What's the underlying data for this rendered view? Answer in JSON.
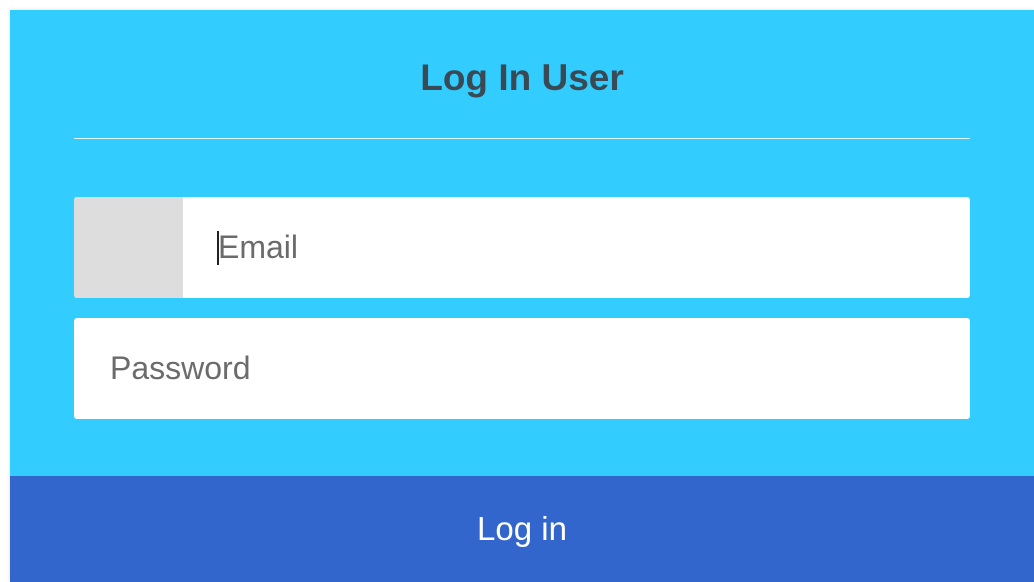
{
  "form": {
    "title": "Log In User",
    "email": {
      "placeholder": "Email",
      "value": ""
    },
    "password": {
      "placeholder": "Password",
      "value": ""
    },
    "submit_label": "Log in"
  },
  "colors": {
    "card_background": "#33ccff",
    "button_background": "#3366cc",
    "title_text": "#3a4a55",
    "input_addon": "#dddddd"
  }
}
